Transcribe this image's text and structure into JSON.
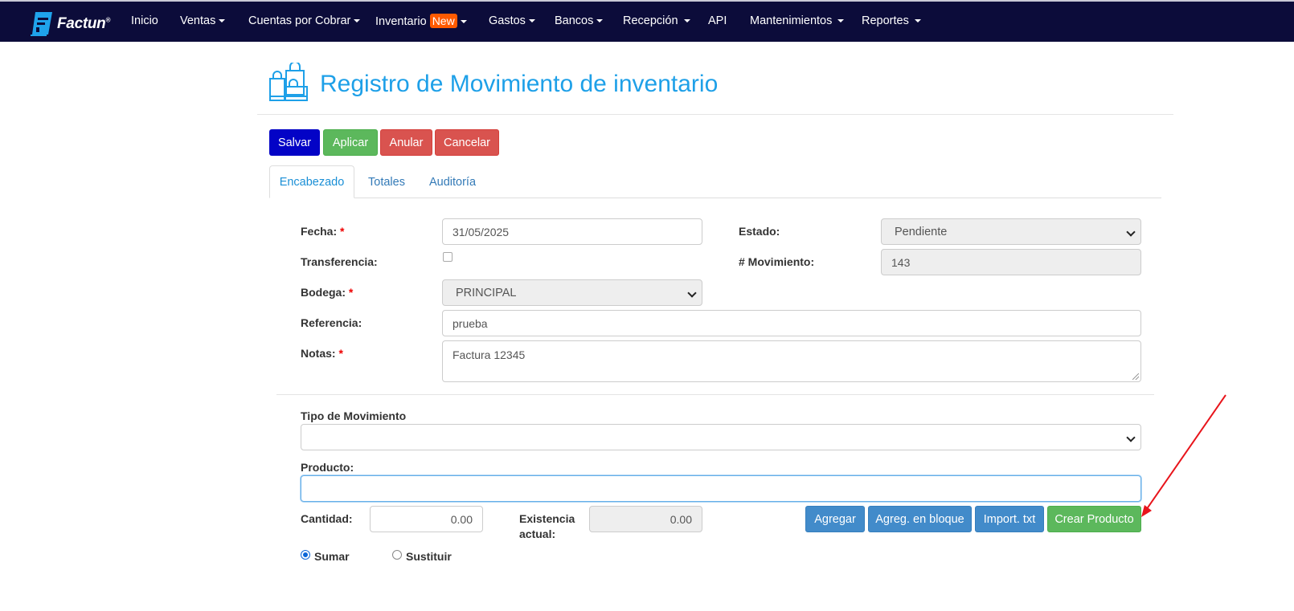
{
  "nav": {
    "brand": "Factun",
    "items": [
      {
        "label": "Inicio"
      },
      {
        "label": "Ventas"
      },
      {
        "label": "Cuentas por Cobrar"
      },
      {
        "label": "Inventario",
        "badge": "New"
      },
      {
        "label": "Gastos"
      },
      {
        "label": "Bancos"
      },
      {
        "label": "Recepción"
      },
      {
        "label": "API"
      },
      {
        "label": "Mantenimientos"
      },
      {
        "label": "Reportes"
      }
    ]
  },
  "page": {
    "title": "Registro de Movimiento de inventario"
  },
  "toolbar": {
    "salvar": "Salvar",
    "aplicar": "Aplicar",
    "anular": "Anular",
    "cancelar": "Cancelar"
  },
  "tabs": [
    {
      "label": "Encabezado",
      "active": true
    },
    {
      "label": "Totales",
      "active": false
    },
    {
      "label": "Auditoría",
      "active": false
    }
  ],
  "form": {
    "fecha_label": "Fecha:",
    "fecha_value": "31/05/2025",
    "estado_label": "Estado:",
    "estado_value": "Pendiente",
    "transferencia_label": "Transferencia:",
    "movimiento_label": "# Movimiento:",
    "movimiento_value": "143",
    "bodega_label": "Bodega:",
    "bodega_value": "PRINCIPAL",
    "referencia_label": "Referencia:",
    "referencia_value": "prueba",
    "notas_label": "Notas:",
    "notas_value": "Factura 12345",
    "required_mark": "*"
  },
  "detail": {
    "tipo_label": "Tipo de Movimiento",
    "tipo_value": "",
    "producto_label": "Producto:",
    "producto_value": "",
    "cantidad_label": "Cantidad:",
    "cantidad_value": "0.00",
    "existencia_label_1": "Existencia",
    "existencia_label_2": "actual:",
    "existencia_value": "0.00",
    "agregar": "Agregar",
    "agregar_bloque": "Agreg. en bloque",
    "import_txt": "Import. txt",
    "crear_producto": "Crear Producto",
    "sumar": "Sumar",
    "sustituir": "Sustituir",
    "mode_selected": "Sumar"
  },
  "colors": {
    "navbar": "#0c0c3a",
    "title": "#1ea0e8",
    "primary": "#0303c6",
    "success": "#5cb85c",
    "danger": "#d9534f",
    "info": "#428bca",
    "annotation_arrow": "#e8141b"
  }
}
